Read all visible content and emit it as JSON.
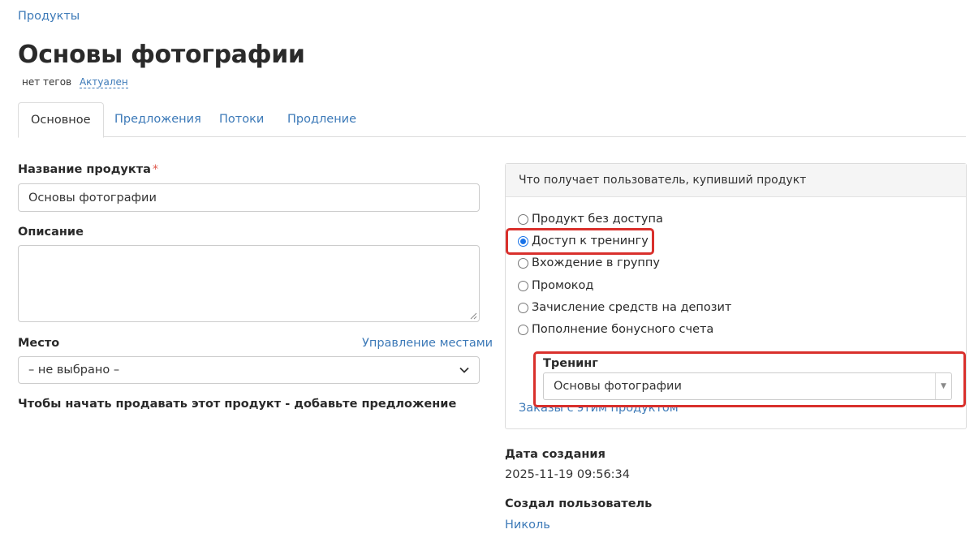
{
  "breadcrumb": {
    "products": "Продукты"
  },
  "page": {
    "title": "Основы фотографии",
    "tags_text": "нет тегов",
    "status": "Актуален"
  },
  "tabs": [
    {
      "label": "Основное",
      "active": true
    },
    {
      "label": "Предложения",
      "active": false
    },
    {
      "label": "Потоки",
      "active": false
    },
    {
      "label": "Продление",
      "active": false
    }
  ],
  "form": {
    "name_label": "Название продукта",
    "required_mark": "*",
    "name_value": "Основы фотографии",
    "description_label": "Описание",
    "description_value": "",
    "place_label": "Место",
    "place_manage_link": "Управление местами",
    "place_selected": "– не выбрано –",
    "start_selling_note": "Чтобы начать продавать этот продукт - добавьте предложение"
  },
  "panel": {
    "header": "Что получает пользователь, купивший продукт",
    "options": [
      {
        "label": "Продукт без доступа",
        "checked": false
      },
      {
        "label": "Доступ к тренингу",
        "checked": true
      },
      {
        "label": "Вхождение в группу",
        "checked": false
      },
      {
        "label": "Промокод",
        "checked": false
      },
      {
        "label": "Зачисление средств на депозит",
        "checked": false
      },
      {
        "label": "Пополнение бонусного счета",
        "checked": false
      }
    ],
    "training_label": "Тренинг",
    "training_selected": "Основы фотографии",
    "orders_link": "Заказы с этим продуктом"
  },
  "info": {
    "created_label": "Дата создания",
    "created_value": "2025-11-19 09:56:34",
    "creator_label": "Создал пользователь",
    "creator_value": "Николь"
  },
  "colors": {
    "link": "#3d7ab8",
    "highlight": "#d9302c",
    "radio_checked": "#1a73e8",
    "required": "#e05a4e"
  }
}
